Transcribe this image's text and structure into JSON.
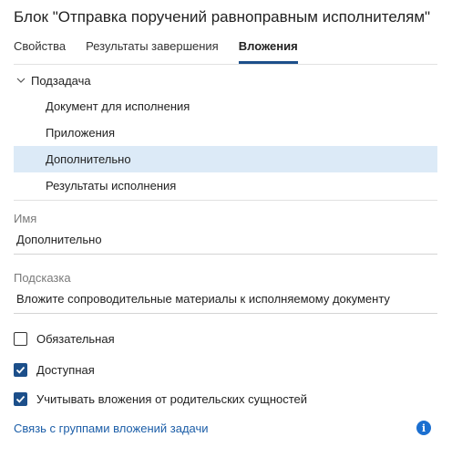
{
  "window": {
    "title": "Блок \"Отправка поручений равноправным исполнителям\""
  },
  "tabs": [
    {
      "label": "Свойства",
      "active": false
    },
    {
      "label": "Результаты завершения",
      "active": false
    },
    {
      "label": "Вложения",
      "active": true
    }
  ],
  "tree": {
    "root": {
      "label": "Подзадача",
      "expanded": true,
      "icon": "chevron-down-icon"
    },
    "items": [
      {
        "label": "Документ для исполнения",
        "selected": false
      },
      {
        "label": "Приложения",
        "selected": false
      },
      {
        "label": "Дополнительно",
        "selected": true
      },
      {
        "label": "Результаты исполнения",
        "selected": false
      }
    ]
  },
  "fields": {
    "name": {
      "label": "Имя",
      "value": "Дополнительно"
    },
    "hint": {
      "label": "Подсказка",
      "value": "Вложите сопроводительные материалы к исполняемому документу"
    }
  },
  "checkboxes": [
    {
      "label": "Обязательная",
      "checked": false
    },
    {
      "label": "Доступная",
      "checked": true
    },
    {
      "label": "Учитывать вложения от родительских сущностей",
      "checked": true
    }
  ],
  "footer": {
    "link_label": "Связь с группами вложений задачи",
    "info_icon": "info-icon",
    "info_glyph": "i"
  },
  "colors": {
    "accent": "#1c4f8a",
    "selection": "#dceaf7",
    "link": "#1c5ea8",
    "info": "#1b6fd0"
  }
}
